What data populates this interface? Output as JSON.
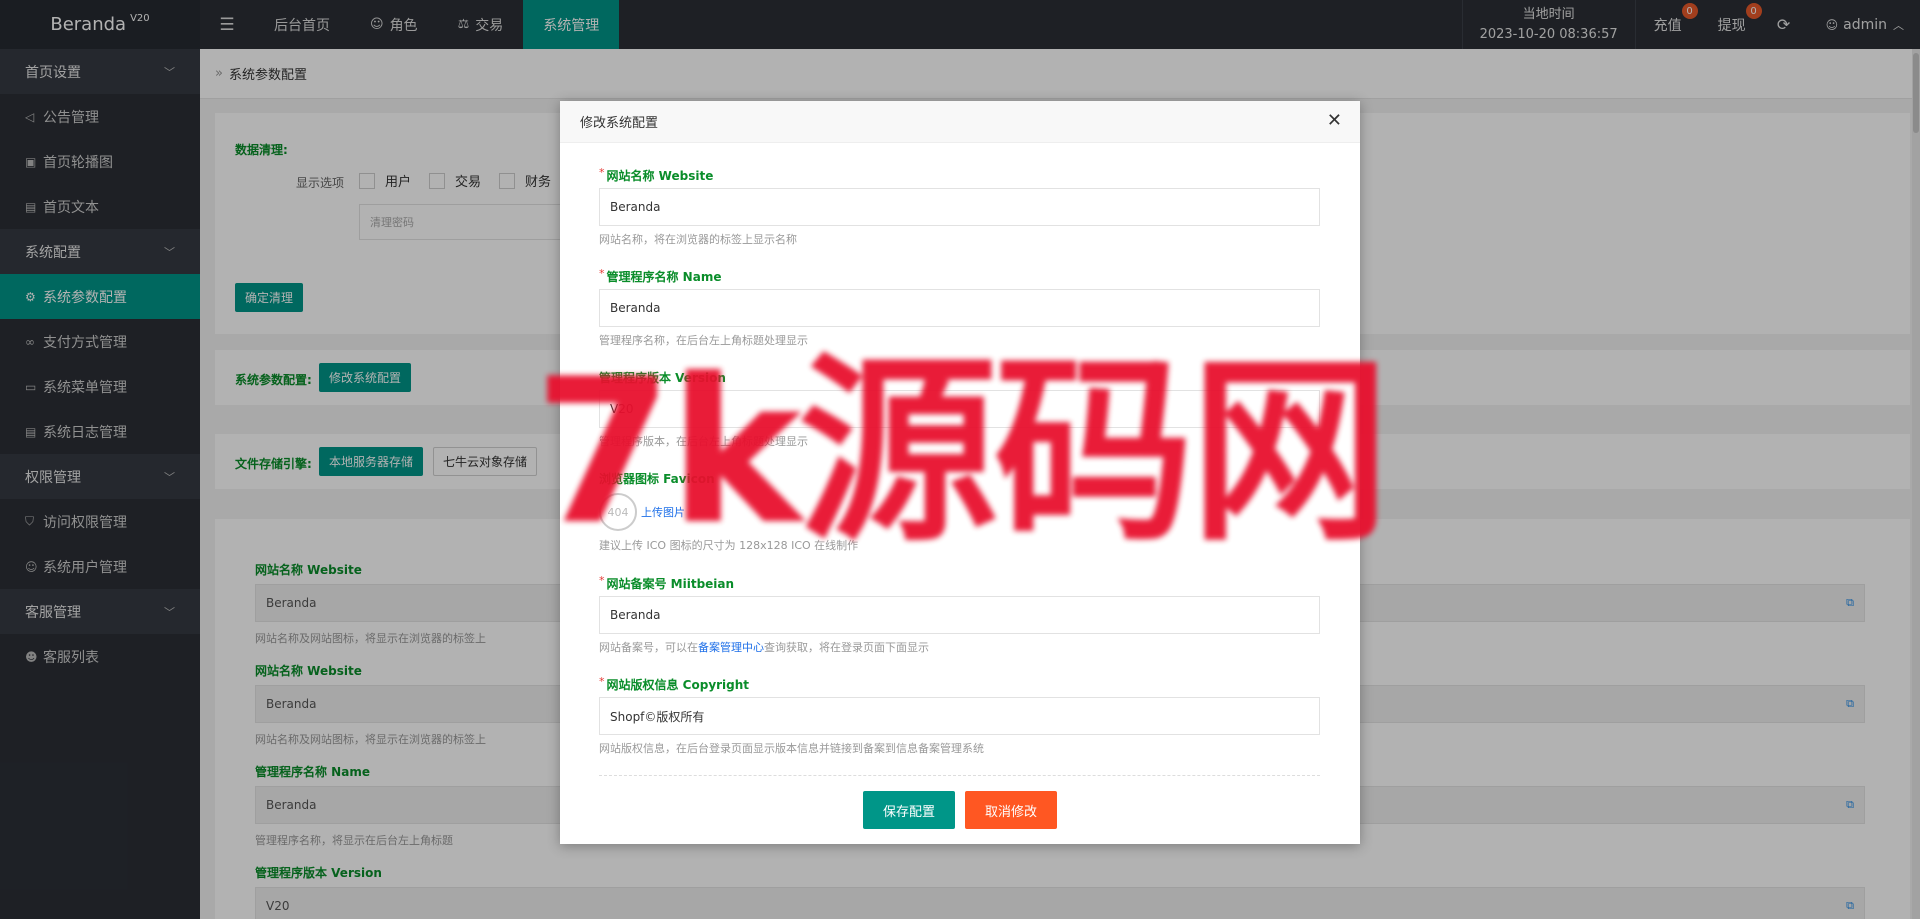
{
  "brand": {
    "name": "Beranda",
    "version": "V20"
  },
  "topnav": {
    "items": [
      {
        "label": "后台首页"
      },
      {
        "label": "角色"
      },
      {
        "label": "交易"
      },
      {
        "label": "系统管理"
      }
    ]
  },
  "topright": {
    "time_label": "当地时间",
    "time_value": "2023-10-20 08:36:57",
    "recharge": "充值",
    "recharge_badge": "0",
    "withdraw": "提现",
    "withdraw_badge": "0",
    "user": "admin"
  },
  "sidebar": {
    "groups": [
      {
        "label": "首页设置",
        "items": [
          "公告管理",
          "首页轮播图",
          "首页文本"
        ]
      },
      {
        "label": "系统配置",
        "items": [
          "系统参数配置",
          "支付方式管理",
          "系统菜单管理",
          "系统日志管理"
        ]
      },
      {
        "label": "权限管理",
        "items": [
          "访问权限管理",
          "系统用户管理"
        ]
      },
      {
        "label": "客服管理",
        "items": [
          "客服列表"
        ]
      }
    ]
  },
  "breadcrumb": "系统参数配置",
  "clean": {
    "title": "数据清理:",
    "options_label": "显示选项",
    "options": [
      "用户",
      "交易",
      "财务"
    ],
    "password_placeholder": "清理密码",
    "confirm_button": "确定清理"
  },
  "sysparams": {
    "label": "系统参数配置:",
    "button": "修改系统配置"
  },
  "storage": {
    "label": "文件存储引擎:",
    "local": "本地服务器存储",
    "qiniu": "七牛云对象存储"
  },
  "bg_fields": [
    {
      "label": "网站名称 Website",
      "value": "Beranda",
      "help": "网站名称及网站图标，将显示在浏览器的标签上"
    },
    {
      "label": "网站名称 Website",
      "value": "Beranda",
      "help": "网站名称及网站图标，将显示在浏览器的标签上"
    },
    {
      "label": "管理程序名称 Name",
      "value": "Beranda",
      "help": "管理程序名称，将显示在后台左上角标题"
    },
    {
      "label": "管理程序版本 Version",
      "value": "V20"
    }
  ],
  "modal": {
    "title": "修改系统配置",
    "close": "✕",
    "f1_label": "网站名称 Website",
    "f1_value": "Beranda",
    "f1_help": "网站名称，将在浏览器的标签上显示名称",
    "f2_label": "管理程序名称 Name",
    "f2_value": "Beranda",
    "f2_help": "管理程序名称，在后台左上角标题处理显示",
    "f3_label": "管理程序版本 Version",
    "f3_value": "V20",
    "f3_help": "管理程序版本，在后台左上角标题处理显示",
    "f4_label": "浏览器图标 Favicon",
    "f4_upload": "上传图片",
    "f4_help": "建议上传 ICO 图标的尺寸为 128x128 ICO 在线制作",
    "f5_label": "网站备案号 Miitbeian",
    "f5_value": "Beranda",
    "f5_help_pre": "网站备案号，可以在",
    "f5_help_link": "备案管理中心",
    "f5_help_post": "查询获取，将在登录页面下面显示",
    "f6_label": "网站版权信息 Copyright",
    "f6_value": "Shopf©版权所有",
    "f6_help": "网站版权信息，在后台登录页面显示版本信息并链接到备案到信息备案管理系统",
    "save": "保存配置",
    "cancel": "取消修改"
  },
  "watermark": "7k源码网"
}
